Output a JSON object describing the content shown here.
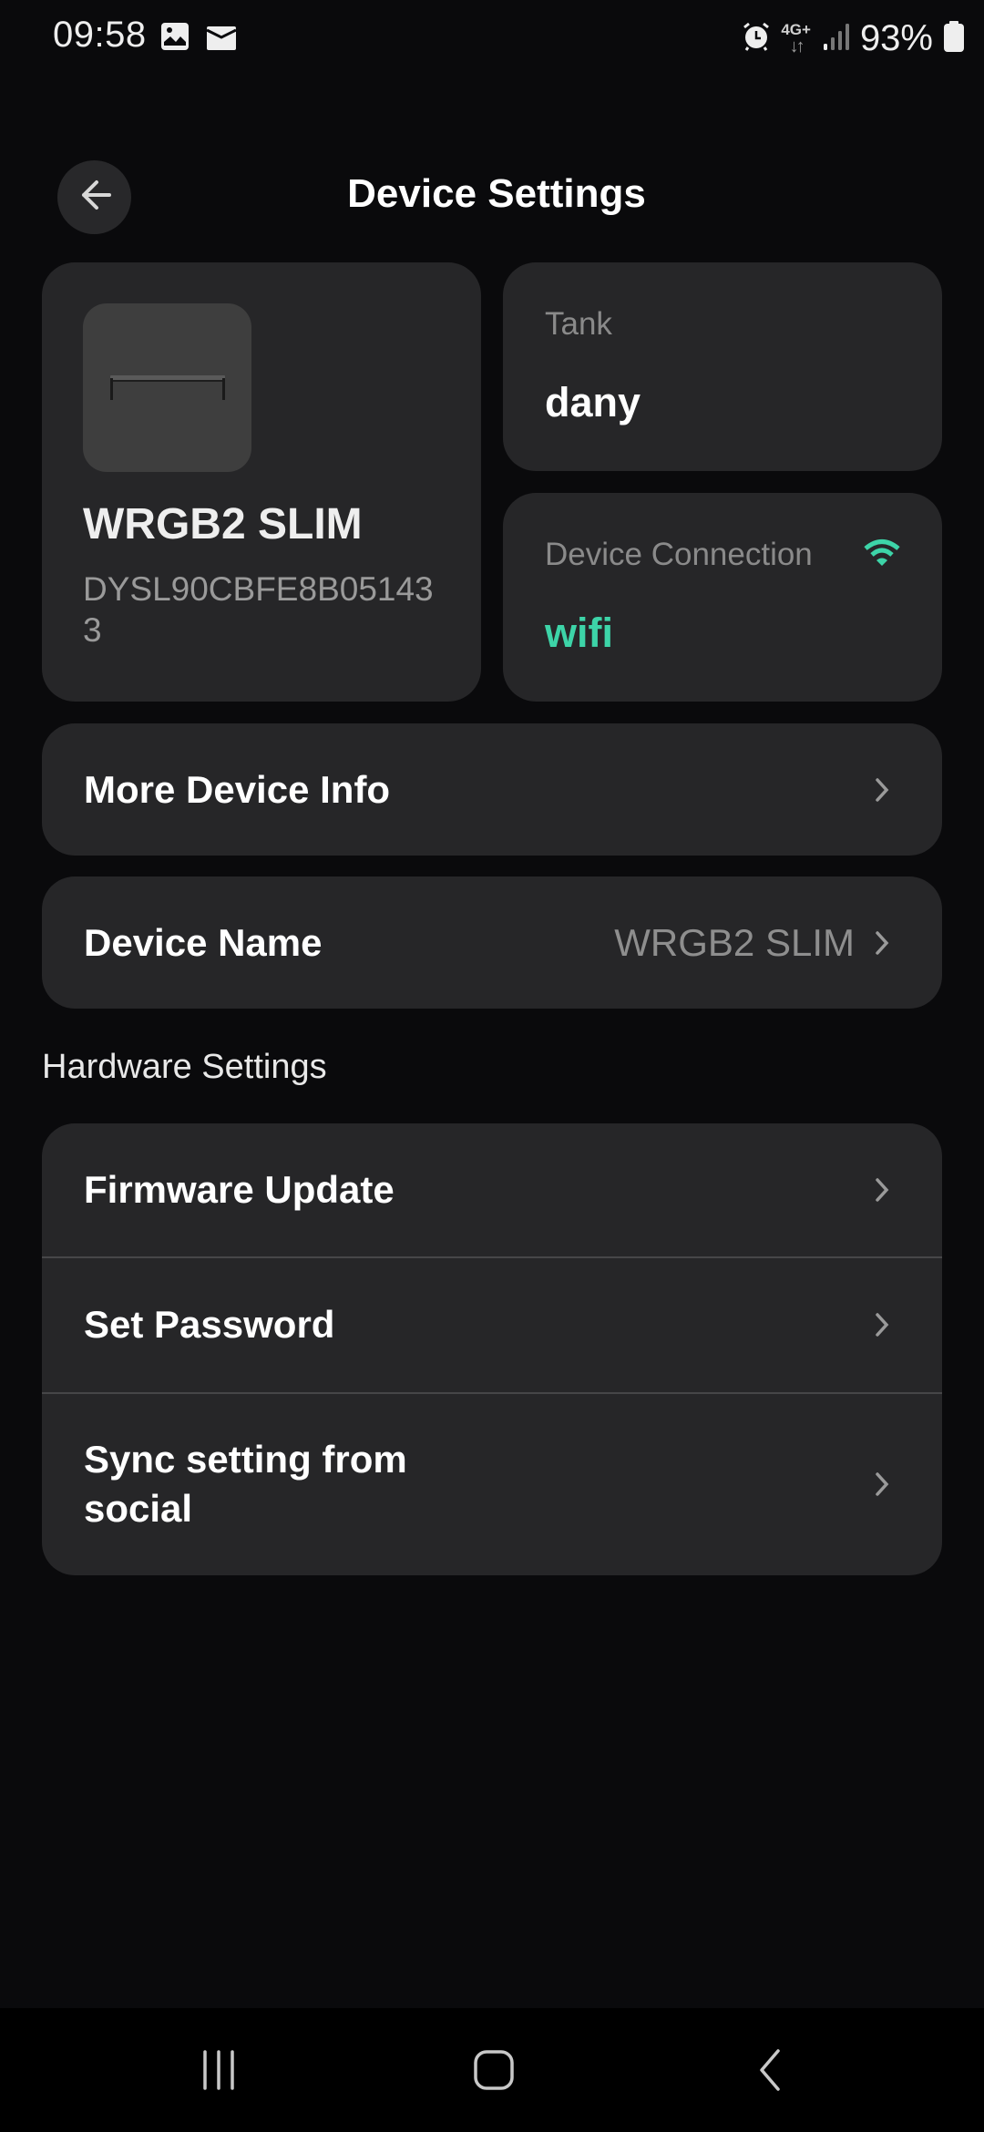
{
  "status_bar": {
    "time": "09:58",
    "notification_icons": [
      "gallery-icon",
      "email-icon"
    ],
    "network_type": "4G+",
    "network_arrows": "↓↑",
    "battery_percent": "93%",
    "status_icons": [
      "alarm-icon",
      "network-4g-icon",
      "signal-icon",
      "battery-icon"
    ]
  },
  "header": {
    "title": "Device Settings",
    "back_icon": "arrow-left-icon"
  },
  "device_card": {
    "name": "WRGB2 SLIM",
    "serial": "DYSL90CBFE8B051433",
    "image": "light-fixture-thumbnail"
  },
  "tank_card": {
    "label": "Tank",
    "value": "dany"
  },
  "connection_card": {
    "label": "Device Connection",
    "value": "wifi",
    "icon": "wifi-icon"
  },
  "rows": {
    "more_info": {
      "label": "More Device Info"
    },
    "device_name": {
      "label": "Device Name",
      "value": "WRGB2 SLIM"
    }
  },
  "hardware": {
    "section_title": "Hardware Settings",
    "items": [
      {
        "label": "Firmware Update"
      },
      {
        "label": "Set Password"
      },
      {
        "label": "Sync setting from social"
      }
    ]
  },
  "colors": {
    "accent": "#3dd4a8",
    "background": "#0a0a0c",
    "card": "#262628",
    "muted_text": "#8a8a8a"
  },
  "nav_bar": {
    "buttons": [
      "recent-apps-icon",
      "home-icon",
      "back-icon"
    ]
  }
}
